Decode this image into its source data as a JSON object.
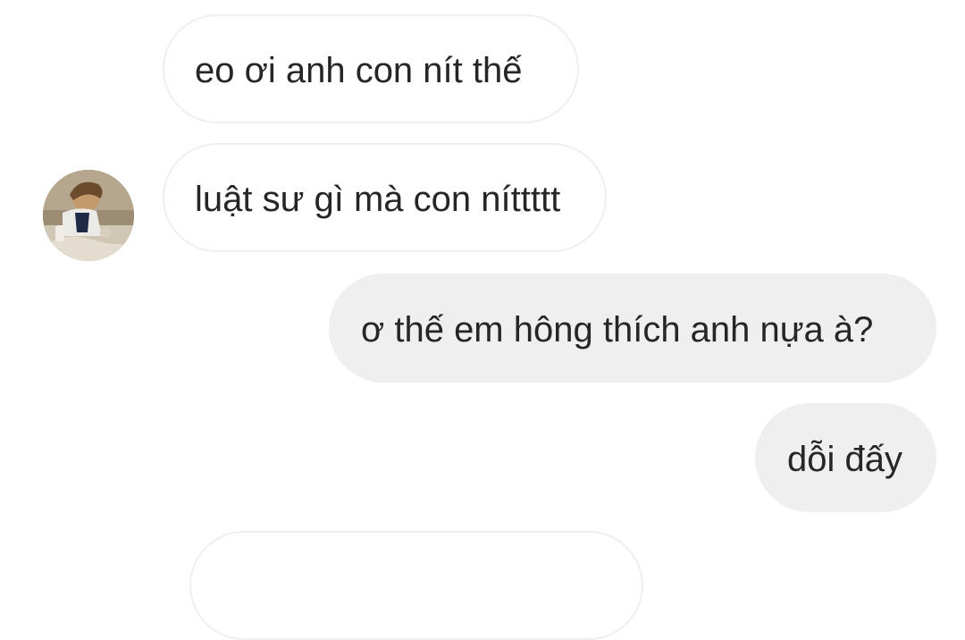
{
  "conversation": {
    "messages": [
      {
        "direction": "incoming",
        "text": "eo ơi anh con nít thế"
      },
      {
        "direction": "incoming",
        "text": "luật sư gì mà con níttttt"
      },
      {
        "direction": "outgoing",
        "text": "ơ thế em hông thích anh nựa à?"
      },
      {
        "direction": "outgoing",
        "text": "dỗi đấy"
      }
    ]
  },
  "colors": {
    "incoming_bubble": "#ffffff",
    "incoming_border": "#efefef",
    "outgoing_bubble": "#efefef",
    "text": "#262626"
  },
  "icons": {
    "contact_avatar": "avatar-photo"
  }
}
